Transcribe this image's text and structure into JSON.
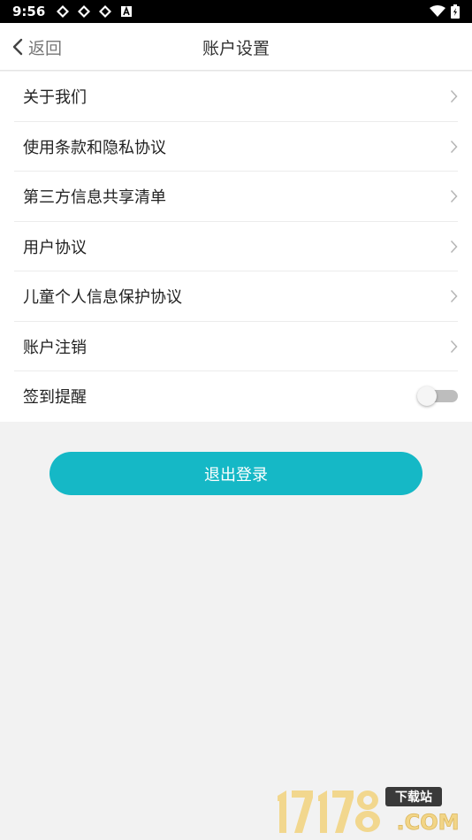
{
  "status": {
    "time": "9:56"
  },
  "header": {
    "back_label": "返回",
    "title": "账户设置"
  },
  "menu": {
    "items": [
      {
        "label": "关于我们"
      },
      {
        "label": "使用条款和隐私协议"
      },
      {
        "label": "第三方信息共享清单"
      },
      {
        "label": "用户协议"
      },
      {
        "label": "儿童个人信息保护协议"
      },
      {
        "label": "账户注销"
      }
    ],
    "reminder": {
      "label": "签到提醒",
      "enabled": false
    }
  },
  "logout": {
    "label": "退出登录"
  },
  "colors": {
    "accent": "#15b8c6"
  },
  "watermark": {
    "number": "17178",
    "tag": "下载站",
    "domain": ".COM"
  }
}
